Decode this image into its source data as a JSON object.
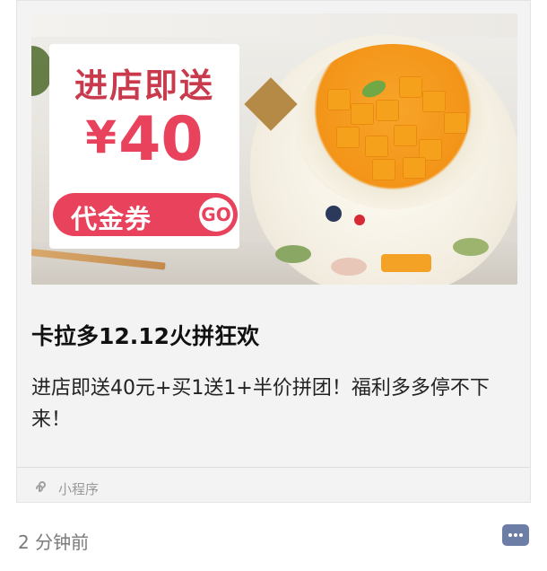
{
  "card": {
    "banner": {
      "headline": "进店即送",
      "currency": "¥",
      "amount": "40",
      "coupon_label": "代金券",
      "go_label": "GO"
    },
    "title": "卡拉多12.12火拼狂欢",
    "description": "进店即送40元+买1送1+半价拼团！福利多多停不下来！",
    "mini_program": {
      "icon": "mini-program-icon",
      "label": "小程序"
    }
  },
  "footer": {
    "time": "2 分钟前",
    "more_icon": "more-options-icon"
  },
  "colors": {
    "accent": "#e8425c",
    "more_button": "#6d7ea6"
  }
}
